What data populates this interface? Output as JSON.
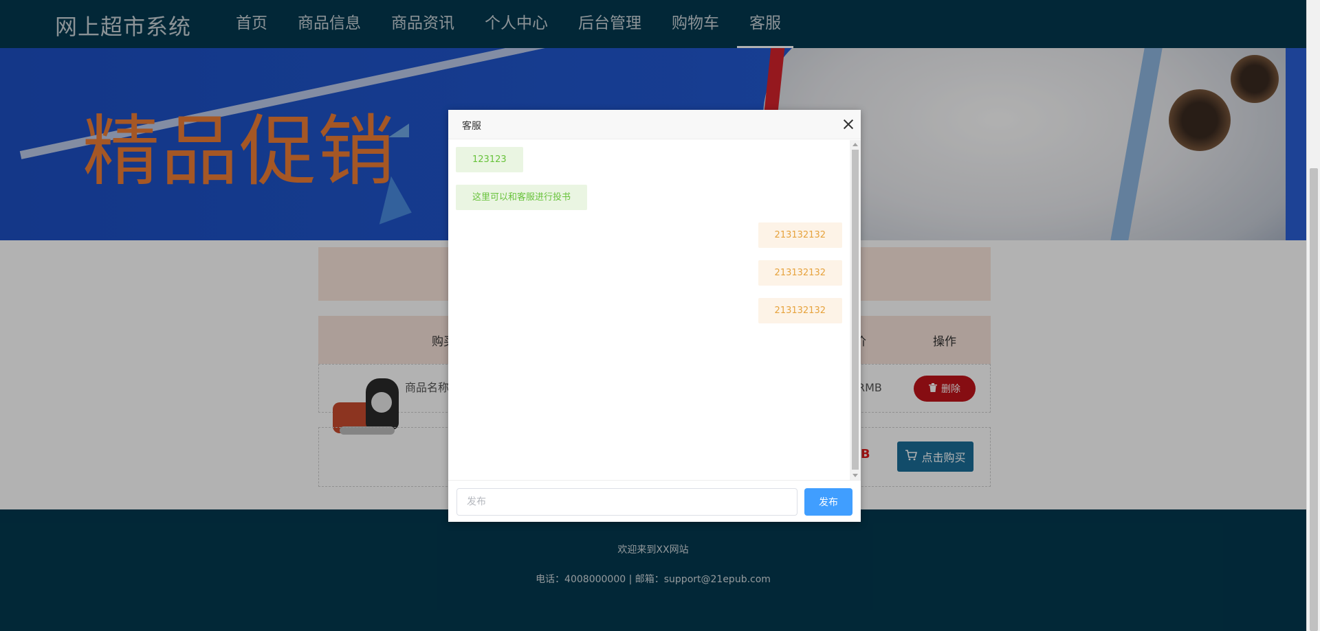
{
  "header": {
    "brand": "网上超市系统",
    "nav": [
      "首页",
      "商品信息",
      "商品资讯",
      "个人中心",
      "后台管理",
      "购物车",
      "客服"
    ],
    "active_nav": "客服"
  },
  "banner": {
    "title": "精品促销"
  },
  "cart": {
    "header_buy": "购买",
    "header_price": "价",
    "header_action": "操作",
    "item_name": "商品名称",
    "item_price_suffix": "RMB",
    "delete_label": "删除",
    "total_suffix": "MB",
    "buy_label": "点击购买"
  },
  "footer": {
    "welcome": "欢迎来到XX网站",
    "contact": "电话：4008000000 | 邮箱：support@21epub.com"
  },
  "dialog": {
    "title": "客服",
    "messages": [
      {
        "side": "left",
        "text": "123123"
      },
      {
        "side": "left",
        "text": "这里可以和客服进行投书"
      },
      {
        "side": "right",
        "text": "213132132"
      },
      {
        "side": "right",
        "text": "213132132"
      },
      {
        "side": "right",
        "text": "213132132"
      }
    ],
    "input_placeholder": "发布",
    "input_value": "",
    "send_label": "发布"
  },
  "colors": {
    "header_bg": "#03394f",
    "send_button": "#409eff",
    "agent_message_text": "#67c23a",
    "user_message_text": "#e6a23c",
    "delete_button": "#c1141a",
    "buy_button": "#1b6e99"
  }
}
